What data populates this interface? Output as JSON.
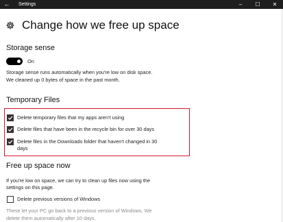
{
  "window": {
    "title": "Settings",
    "back_glyph": "←",
    "minimize_glyph": "–",
    "maximize_glyph": "☐",
    "close_glyph": "✕"
  },
  "page": {
    "title": "Change how we free up space",
    "icon": "gear-icon"
  },
  "storage_sense": {
    "heading": "Storage sense",
    "toggle_state": "On",
    "toggle_on": true,
    "desc_line1": "Storage sense runs automatically when you're low on disk space.",
    "desc_line2": "We cleaned up 0 bytes of space in the past month."
  },
  "temporary_files": {
    "heading": "Temporary Files",
    "items": [
      {
        "label": "Delete temporary files that my apps aren't using",
        "checked": true
      },
      {
        "label": "Delete files that have been in the recycle bin for over 30 days",
        "checked": true
      },
      {
        "label_line1": "Delete files in the Downloads folder that haven't changed in 30",
        "label_line2": "days",
        "checked": true
      }
    ]
  },
  "free_up": {
    "heading": "Free up space now",
    "desc_line1": "If you're low on space, we can try to clean up files now using the",
    "desc_line2": "settings on this page.",
    "checkbox_label": "Delete previous versions of Windows",
    "checkbox_checked": false,
    "note_line1": "These let your PC go back to a previous version of Windows. We",
    "note_line2": "delete them automatically after 10 days."
  },
  "colors": {
    "highlight_border": "#d0142b",
    "titlebar_bg": "#1f1f1f",
    "toggle_on": "#000000"
  }
}
